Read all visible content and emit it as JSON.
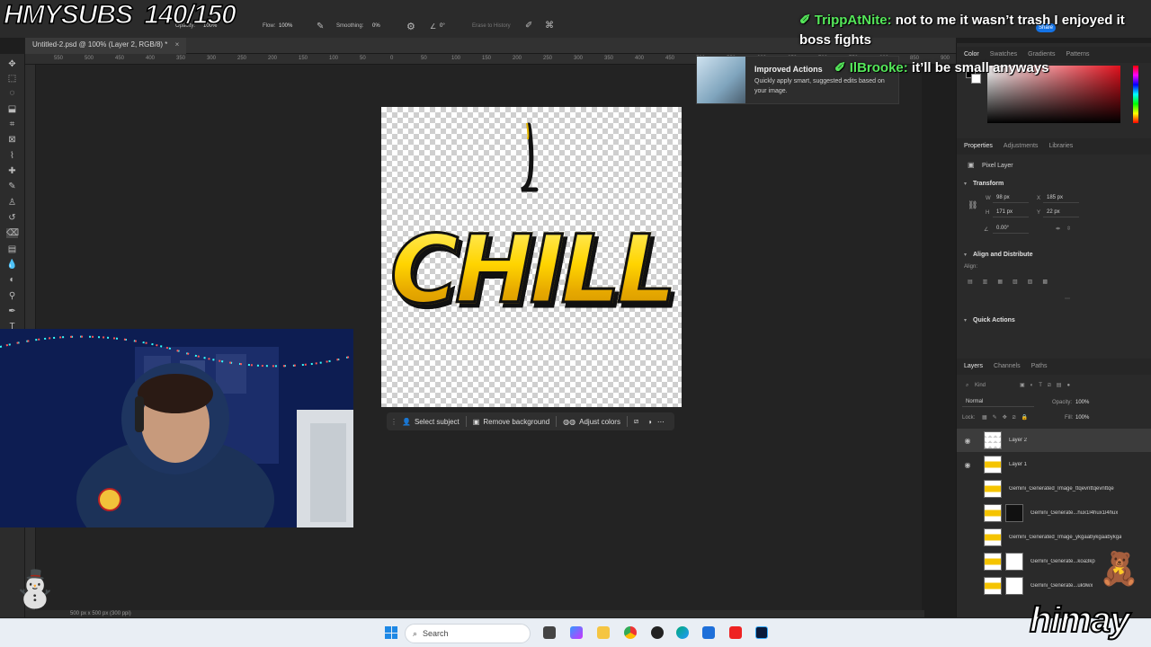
{
  "stream_overlay": {
    "subs_label": "HMYSUBS",
    "subs_count": "140/150",
    "chat_line1_user": "TrippAtNite:",
    "chat_line1_text": " not to me it wasn’t trash I enjoyed it",
    "chat_line1_cont": "boss fights",
    "chat_line2_user": "IlBrooke:",
    "chat_line2_text": " it’ll be small anyways",
    "brand_text": "himay"
  },
  "options_bar": {
    "opacity_label": "Opacity:",
    "opacity_value": "100%",
    "flow_label": "Flow:",
    "flow_value": "100%",
    "smoothing_label": "Smoothing:",
    "smoothing_value": "0%",
    "angle_value": "0°",
    "erase_to_history": "Erase to History",
    "share_label": "Share"
  },
  "document": {
    "tab_title": "Untitled-2.psd @ 100% (Layer 2, RGB/8) *",
    "canvas_text": "CHILL",
    "status_text": "500 px x 500 px (300 ppi)"
  },
  "ruler_ticks": [
    "550",
    "500",
    "450",
    "400",
    "350",
    "300",
    "250",
    "200",
    "150",
    "100",
    "50",
    "0",
    "50",
    "100",
    "150",
    "200",
    "250",
    "300",
    "350",
    "400",
    "450",
    "500",
    "550",
    "600",
    "650",
    "700",
    "750",
    "800",
    "850",
    "900"
  ],
  "context_bar": {
    "select_subject": "Select subject",
    "remove_background": "Remove background",
    "adjust_colors": "Adjust colors"
  },
  "tooltip": {
    "title": "Improved Actions",
    "description": "Quickly apply smart, suggested edits based on your image."
  },
  "color_panel": {
    "tabs": [
      "Color",
      "Swatches",
      "Gradients",
      "Patterns"
    ],
    "foreground": "#000000",
    "background": "#ffffff"
  },
  "properties_panel": {
    "tabs": [
      "Properties",
      "Adjustments",
      "Libraries"
    ],
    "layer_kind": "Pixel Layer",
    "transform_title": "Transform",
    "w_label": "W",
    "w_value": "98 px",
    "h_label": "H",
    "h_value": "171 px",
    "x_label": "X",
    "x_value": "185 px",
    "y_label": "Y",
    "y_value": "22 px",
    "angle_value": "0.00°",
    "align_title": "Align and Distribute",
    "align_label": "Align:",
    "quick_actions": "Quick Actions"
  },
  "layers_panel": {
    "tabs": [
      "Layers",
      "Channels",
      "Paths"
    ],
    "filter_kind": "Kind",
    "blend_mode": "Normal",
    "opacity_label": "Opacity:",
    "opacity_value": "100%",
    "lock_label": "Lock:",
    "fill_label": "Fill:",
    "fill_value": "100%",
    "layers": [
      {
        "name": "Layer 2"
      },
      {
        "name": "Layer 1"
      },
      {
        "name": "Gemini_Generated_Image_ttqevnttqevnttqe"
      },
      {
        "name": "Gemini_Generate...hux1l4hux1l4hux"
      },
      {
        "name": "Gemini_Generated_Image_ykgaabykgaabykga"
      },
      {
        "name": "Gemini_Generate...koa3kp"
      },
      {
        "name": "Gemini_Generate...uk9wx"
      }
    ]
  },
  "taskbar": {
    "search_placeholder": "Search"
  }
}
